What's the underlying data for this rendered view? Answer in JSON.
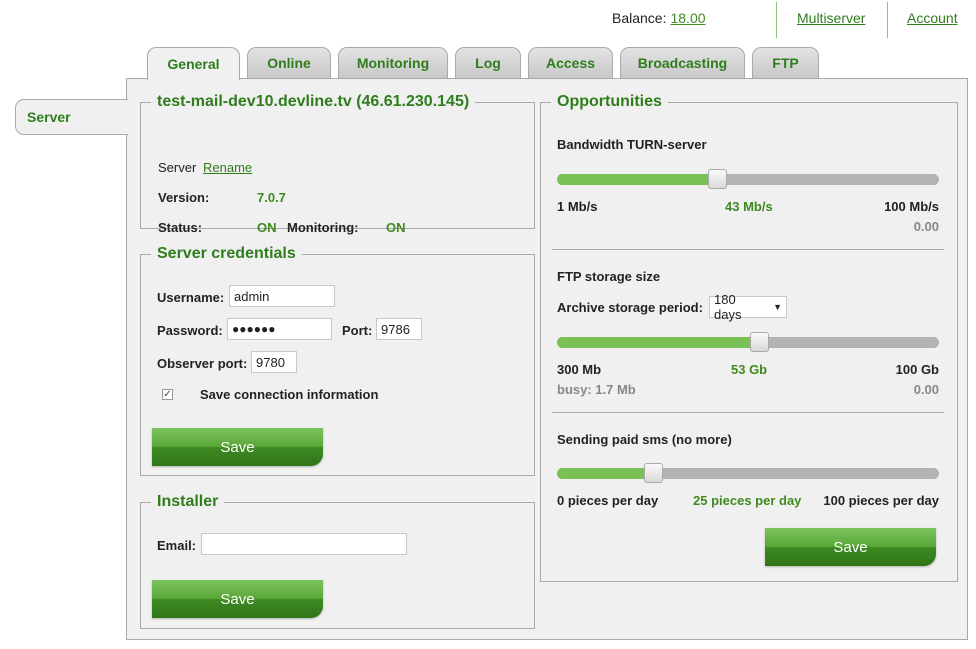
{
  "header": {
    "balance_label": "Balance:",
    "balance_value": "18.00",
    "multiserver": "Multiserver",
    "account": "Account"
  },
  "tabs": [
    "General",
    "Online",
    "Monitoring",
    "Log",
    "Access",
    "Broadcasting",
    "FTP"
  ],
  "active_tab": "General",
  "side_tab": "Server",
  "server": {
    "title": "test-mail-dev10.devline.tv (46.61.230.145)",
    "server_label": "Server",
    "rename_link": "Rename",
    "version_label": "Version:",
    "version_value": "7.0.7",
    "status_label": "Status:",
    "status_value": "ON",
    "monitoring_label": "Monitoring:",
    "monitoring_value": "ON"
  },
  "credentials": {
    "legend": "Server credentials",
    "username_label": "Username:",
    "username_value": "admin",
    "password_label": "Password:",
    "password_value": "●●●●●●",
    "port_label": "Port:",
    "port_value": "9786",
    "observer_port_label": "Observer port:",
    "observer_port_value": "9780",
    "save_connection_label": "Save connection information",
    "save_connection_checked": true,
    "save_button": "Save"
  },
  "installer": {
    "legend": "Installer",
    "email_label": "Email:",
    "email_value": "",
    "save_button": "Save"
  },
  "opportunities": {
    "legend": "Opportunities",
    "bandwidth": {
      "title": "Bandwidth TURN-server",
      "min": "1 Mb/s",
      "current": "43 Mb/s",
      "max": "100 Mb/s",
      "cost": "0.00",
      "level": 0.42
    },
    "ftp": {
      "title": "FTP storage size",
      "archive_label": "Archive storage period:",
      "archive_value": "180 days",
      "min": "300 Mb",
      "current": "53 Gb",
      "max": "100 Gb",
      "busy": "busy: 1.7 Mb",
      "cost": "0.00",
      "level": 0.53
    },
    "sms": {
      "title": "Sending paid sms (no more)",
      "min": "0 pieces per day",
      "current": "25 pieces per day",
      "max": "100 pieces per day",
      "level": 0.25
    },
    "save_button": "Save"
  },
  "colors": {
    "accent_green": "#2f7d1c",
    "slider_fill": "#79c154",
    "slider_track": "#b3b3b3",
    "panel_bg": "#f0f0f0"
  }
}
